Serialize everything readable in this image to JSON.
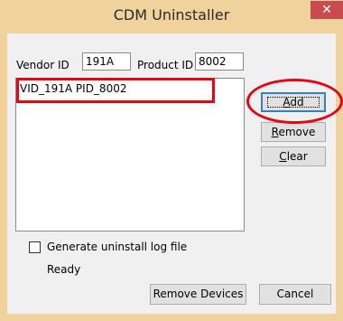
{
  "window": {
    "title": "CDM Uninstaller",
    "close_glyph": "✕"
  },
  "vendor": {
    "label": "Vendor ID",
    "value": "191A"
  },
  "product": {
    "label": "Product ID",
    "value": "8002"
  },
  "list": {
    "items": [
      "VID_191A PID_8002"
    ]
  },
  "buttons": {
    "add": {
      "pre": "",
      "mnemonic": "A",
      "post": "dd"
    },
    "remove": {
      "pre": "",
      "mnemonic": "R",
      "post": "emove"
    },
    "clear": {
      "pre": "",
      "mnemonic": "C",
      "post": "lear"
    },
    "remove_devices": "Remove Devices",
    "cancel": "Cancel"
  },
  "log": {
    "label": "Generate uninstall log file",
    "checked": false
  },
  "status": "Ready",
  "annotation_color": "#e30613"
}
